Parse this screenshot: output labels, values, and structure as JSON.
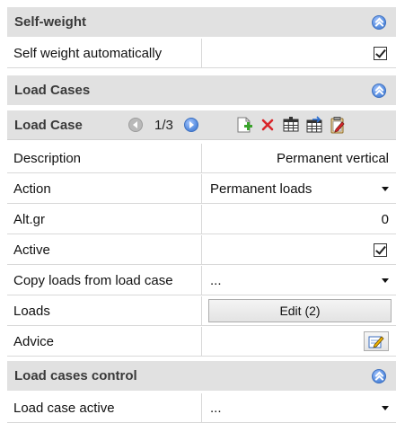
{
  "sections": {
    "self_weight": "Self-weight",
    "load_cases": "Load Cases",
    "load_cases_control": "Load cases control"
  },
  "self_weight": {
    "auto_label": "Self weight automatically",
    "auto_checked": true
  },
  "load_case_nav": {
    "label": "Load Case",
    "pager": "1/3",
    "toolbar_icons": [
      "new-load-case-icon",
      "delete-icon",
      "table-icon",
      "import-table-icon",
      "clipboard-edit-icon"
    ]
  },
  "properties": {
    "description": {
      "label": "Description",
      "value": "Permanent vertical"
    },
    "action": {
      "label": "Action",
      "value": "Permanent loads"
    },
    "alt_gr": {
      "label": "Alt.gr",
      "value": "0"
    },
    "active": {
      "label": "Active",
      "checked": true
    },
    "copy_loads": {
      "label": "Copy loads from load case",
      "value": "..."
    },
    "loads": {
      "label": "Loads",
      "button": "Edit (2)"
    },
    "advice": {
      "label": "Advice"
    }
  },
  "control": {
    "load_case_active": {
      "label": "Load case active",
      "value": "..."
    }
  },
  "colors": {
    "section_bg": "#e1e1e1",
    "accent_blue": "#5a8fe0",
    "delete_red": "#d9252a",
    "add_green": "#3aa32c"
  }
}
